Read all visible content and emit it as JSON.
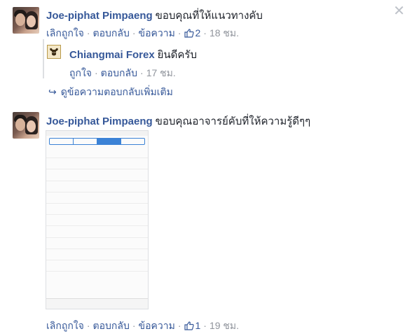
{
  "comment1": {
    "author": "Joe-piphat Pimpaeng",
    "text": "ขอบคุณที่ให้แนวทางคับ",
    "unlike": "เลิกถูกใจ",
    "reply": "ตอบกลับ",
    "message": "ข้อความ",
    "likes": "2",
    "time": "18 ชม."
  },
  "reply1": {
    "author": "Chiangmai Forex",
    "text": "ยินดีครับ",
    "like": "ถูกใจ",
    "reply": "ตอบกลับ",
    "time": "17 ชม."
  },
  "more_replies": "ดูข้อความตอบกลับเพิ่มเติม",
  "comment2": {
    "author": "Joe-piphat Pimpaeng",
    "text": "ขอบคุณอาจารย์คับที่ให้ความรู้ดีๆๆ",
    "unlike": "เลิกถูกใจ",
    "reply": "ตอบกลับ",
    "message": "ข้อความ",
    "likes": "1",
    "time": "19 ชม."
  },
  "close_icon": "close-icon",
  "colors": {
    "link": "#365899",
    "muted": "#90949c",
    "accent": "#3b82d6"
  }
}
